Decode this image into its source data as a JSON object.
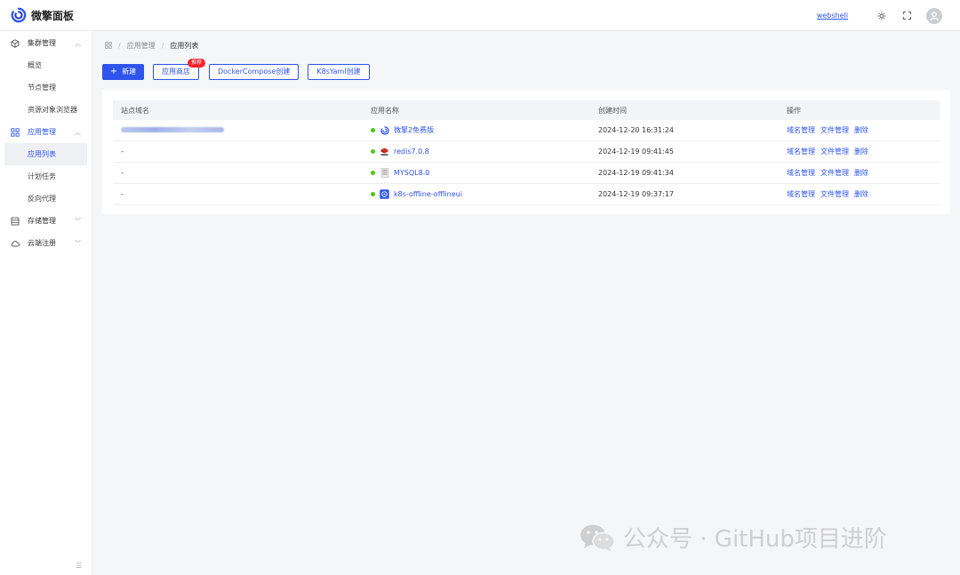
{
  "header": {
    "app_name": "微擎面板",
    "webshell_label": "webshell",
    "theme_icon": "sun-icon",
    "fullscreen_icon": "fullscreen-icon",
    "avatar_icon": "user-avatar-icon"
  },
  "sidebar": {
    "groups": [
      {
        "label": "集群管理",
        "icon": "cube-icon",
        "expanded": true,
        "items": [
          "概览",
          "节点管理",
          "资源对象浏览器"
        ]
      },
      {
        "label": "应用管理",
        "icon": "grid-icon",
        "expanded": true,
        "items": [
          "应用列表",
          "计划任务",
          "反向代理"
        ]
      },
      {
        "label": "存储管理",
        "icon": "storage-icon",
        "expanded": false,
        "items": []
      },
      {
        "label": "云端注册",
        "icon": "cloud-icon",
        "expanded": false,
        "items": []
      }
    ],
    "collapse_icon": "collapse-icon"
  },
  "breadcrumb": {
    "home_icon": "grid-icon",
    "items": [
      "应用管理",
      "应用列表"
    ]
  },
  "toolbar": {
    "new_label": "新建",
    "store_label": "应用商店",
    "store_badge": "推荐",
    "compose_label": "DockerCompose创建",
    "k8s_label": "K8sYaml创建"
  },
  "table": {
    "headers": [
      "站点域名",
      "应用名称",
      "创建时间",
      "操作"
    ],
    "rows": [
      {
        "domain": "",
        "domain_blurred": true,
        "app_name": "微擎2免费版",
        "icon": "w7-icon",
        "status": "running",
        "created": "2024-12-20 16:31:24"
      },
      {
        "domain": "-",
        "domain_blurred": false,
        "app_name": "redis7.0.8",
        "icon": "redis-icon",
        "status": "running",
        "created": "2024-12-19 09:41:45"
      },
      {
        "domain": "-",
        "domain_blurred": false,
        "app_name": "MYSQL8.0",
        "icon": "mysql-icon",
        "status": "running",
        "created": "2024-12-19 09:41:34"
      },
      {
        "domain": "-",
        "domain_blurred": false,
        "app_name": "k8s-offline-offlineui",
        "icon": "k8s-icon",
        "status": "running",
        "created": "2024-12-19 09:37:17"
      }
    ],
    "actions": [
      "域名管理",
      "文件管理",
      "删除"
    ]
  },
  "watermark": {
    "text": "公众号 · GitHub项目进阶",
    "icon": "wechat-icon"
  },
  "colors": {
    "primary": "#2f54eb",
    "badge": "#f5222d",
    "status_running": "#52c41a"
  }
}
